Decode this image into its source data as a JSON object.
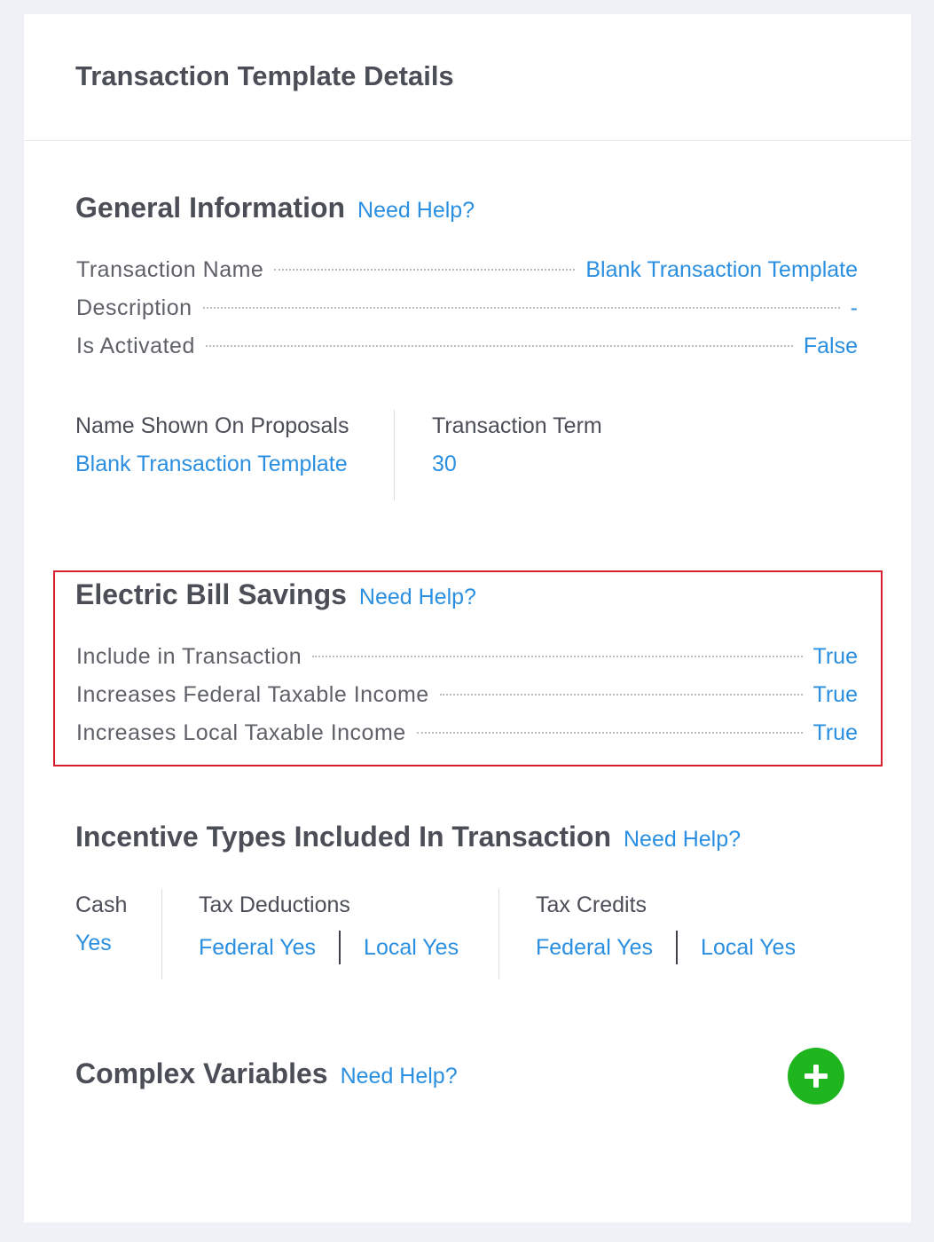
{
  "page": {
    "title": "Transaction Template Details"
  },
  "general": {
    "title": "General Information",
    "help": "Need Help?",
    "rows": [
      {
        "key": "Transaction Name",
        "value": "Blank Transaction Template"
      },
      {
        "key": "Description",
        "value": "-"
      },
      {
        "key": "Is Activated",
        "value": "False"
      }
    ],
    "proposal_label": "Name Shown On Proposals",
    "proposal_value": "Blank Transaction Template",
    "term_label": "Transaction Term",
    "term_value": "30"
  },
  "electric": {
    "title": "Electric Bill Savings",
    "help": "Need Help?",
    "rows": [
      {
        "key": "Include in Transaction",
        "value": "True"
      },
      {
        "key": "Increases Federal Taxable Income",
        "value": "True"
      },
      {
        "key": "Increases Local Taxable Income",
        "value": "True"
      }
    ]
  },
  "incentives": {
    "title": "Incentive Types Included In Transaction",
    "help": "Need Help?",
    "cash_label": "Cash",
    "cash_value": "Yes",
    "deductions_label": "Tax Deductions",
    "deductions_federal": "Federal Yes",
    "deductions_local": "Local Yes",
    "credits_label": "Tax Credits",
    "credits_federal": "Federal Yes",
    "credits_local": "Local Yes"
  },
  "complex": {
    "title": "Complex Variables",
    "help": "Need Help?",
    "add_icon": "plus-icon"
  },
  "colors": {
    "accent": "#2a8fe0",
    "highlight": "#d81e2f",
    "add_button": "#1fb51f"
  }
}
